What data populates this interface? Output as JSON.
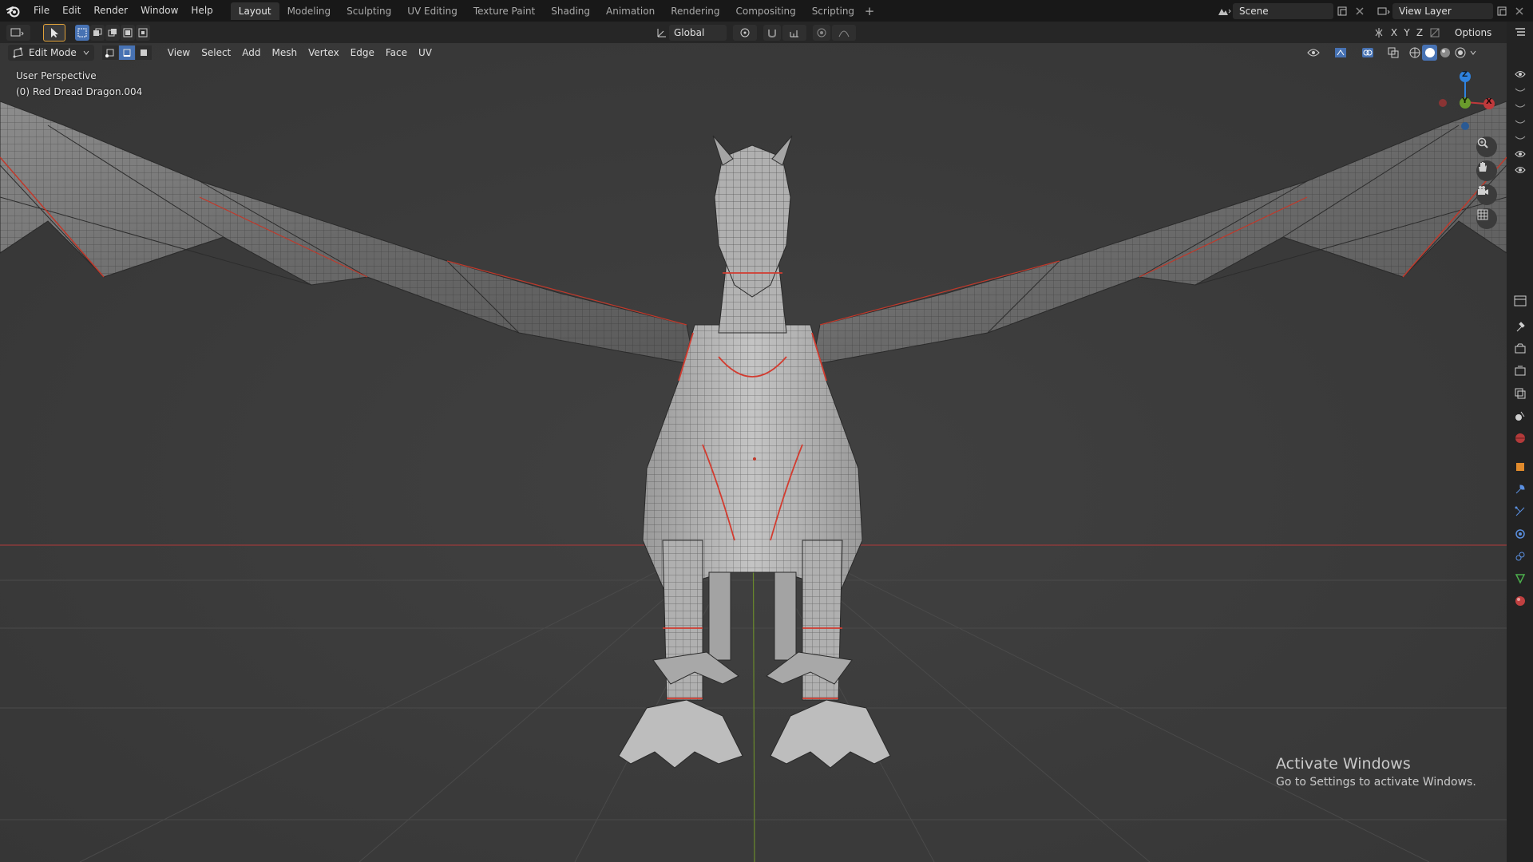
{
  "menu": [
    "File",
    "Edit",
    "Render",
    "Window",
    "Help"
  ],
  "workspaces": [
    "Layout",
    "Modeling",
    "Sculpting",
    "UV Editing",
    "Texture Paint",
    "Shading",
    "Animation",
    "Rendering",
    "Compositing",
    "Scripting"
  ],
  "active_workspace": "Layout",
  "add_workspace": "+",
  "scene": {
    "name": "Scene",
    "view_layer": "View Layer"
  },
  "toolbar": {
    "transform_orientation": "Global",
    "axes": [
      "X",
      "Y",
      "Z"
    ],
    "options_label": "Options"
  },
  "edit_header": {
    "mode": "Edit Mode",
    "menus": [
      "View",
      "Select",
      "Add",
      "Mesh",
      "Vertex",
      "Edge",
      "Face",
      "UV"
    ]
  },
  "viewport": {
    "perspective_label": "User Perspective",
    "object_label": "(0) Red Dread Dragon.004"
  },
  "gizmo": {
    "z": "Z",
    "y": "Y",
    "x": "X"
  },
  "watermark": {
    "title": "Activate Windows",
    "subtitle": "Go to Settings to activate Windows."
  },
  "colors": {
    "accent_blue": "#4772b3",
    "seam_red": "#d23c30",
    "axis_x": "#c0393b",
    "axis_y": "#6a9b2c",
    "axis_z": "#2f83e0"
  }
}
